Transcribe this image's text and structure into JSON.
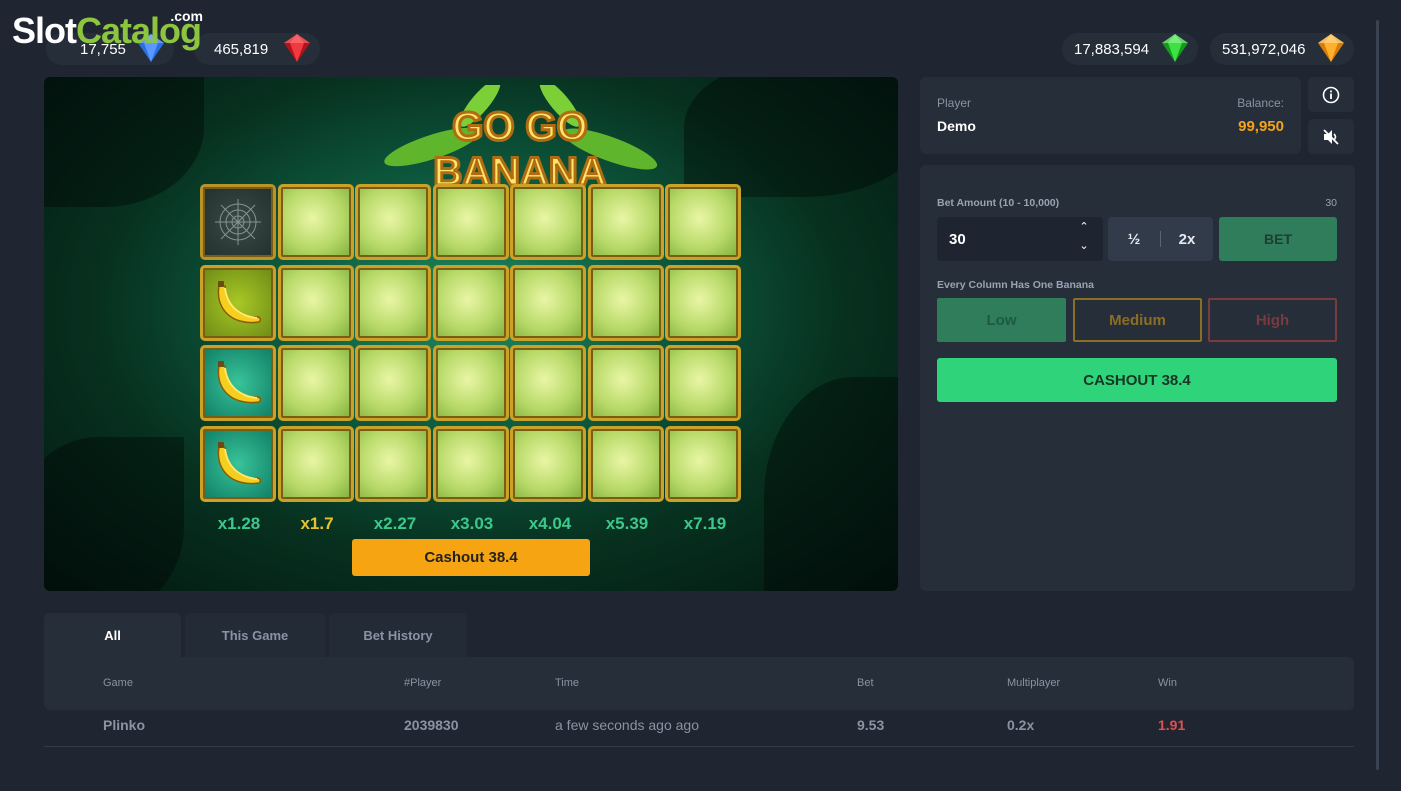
{
  "watermark": {
    "part1": "Slot",
    "part2": "Catalog",
    "part3": ".com"
  },
  "jackpots": [
    {
      "value": "17,755",
      "gem": "blue-gem-icon",
      "color": "#2a6fe0"
    },
    {
      "value": "465,819",
      "gem": "red-gem-icon",
      "color": "#d8242b"
    },
    {
      "value": "17,883,594",
      "gem": "green-gem-icon",
      "color": "#27c22e"
    },
    {
      "value": "531,972,046",
      "gem": "orange-gem-icon",
      "color": "#f29a14"
    }
  ],
  "game": {
    "title_line1": "GO GO",
    "title_line2": "BANANA",
    "multipliers": [
      "x1.28",
      "x1.7",
      "x2.27",
      "x3.03",
      "x4.04",
      "x5.39",
      "x7.19"
    ],
    "cashout_label": "Cashout 38.4",
    "revealed_column": [
      "web",
      "banana",
      "banana",
      "banana"
    ]
  },
  "player": {
    "label": "Player",
    "name": "Demo",
    "balance_label": "Balance:",
    "balance": "99,950"
  },
  "bet": {
    "label": "Bet Amount (10 - 10,000)",
    "current": "30",
    "value": "30",
    "half_label": "½",
    "double_label": "2x",
    "bet_label": "BET",
    "risk_label": "Every Column Has One Banana",
    "risk_low": "Low",
    "risk_medium": "Medium",
    "risk_high": "High",
    "cashout_label": "CASHOUT 38.4"
  },
  "history": {
    "tabs": [
      "All",
      "This Game",
      "Bet History"
    ],
    "columns": [
      "Game",
      "#Player",
      "Time",
      "Bet",
      "Multiplayer",
      "Win"
    ],
    "rows": [
      {
        "game": "Plinko",
        "player": "2039830",
        "time": "a few seconds ago ago",
        "bet": "9.53",
        "multiplier": "0.2x",
        "win": "1.91"
      }
    ]
  },
  "colors": {
    "accent_green": "#2fd37a",
    "accent_orange": "#f7a413",
    "balance": "#f2a31b",
    "bg": "#1f2631"
  }
}
